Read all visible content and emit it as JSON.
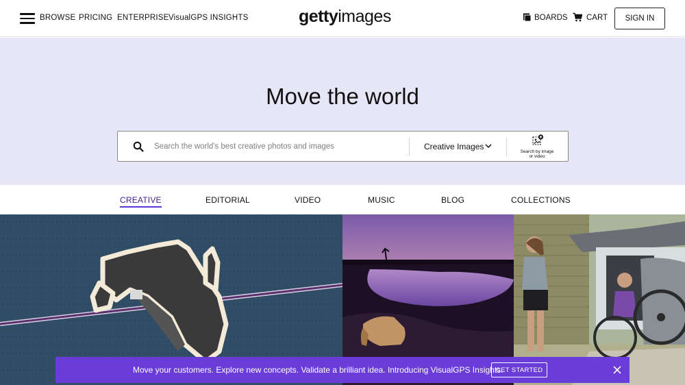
{
  "header": {
    "nav": [
      "BROWSE",
      "PRICING",
      "ENTERPRISE",
      "VisualGPS INSIGHTS"
    ],
    "logo_left": "getty",
    "logo_right": "images",
    "boards_label": "BOARDS",
    "cart_label": "CART",
    "sign_in_label": "SIGN IN"
  },
  "hero": {
    "title": "Move the world",
    "search_placeholder": "Search the world's best creative photos and images",
    "search_type": "Creative Images",
    "image_search_label_line1": "Search by image",
    "image_search_label_line2": "or video"
  },
  "tabs": [
    {
      "label": "CREATIVE",
      "active": true
    },
    {
      "label": "EDITORIAL",
      "active": false
    },
    {
      "label": "VIDEO",
      "active": false
    },
    {
      "label": "MUSIC",
      "active": false
    },
    {
      "label": "BLOG",
      "active": false
    },
    {
      "label": "COLLECTIONS",
      "active": false
    }
  ],
  "banner": {
    "text": "Move your customers. Explore new concepts. Validate a brilliant idea. Introducing VisualGPS Insights.",
    "button_label": "GET STARTED"
  },
  "colors": {
    "hero_bg": "#e6e6f7",
    "banner_bg": "#6a3cd8",
    "active_tab_underline": "#5b35d5"
  }
}
